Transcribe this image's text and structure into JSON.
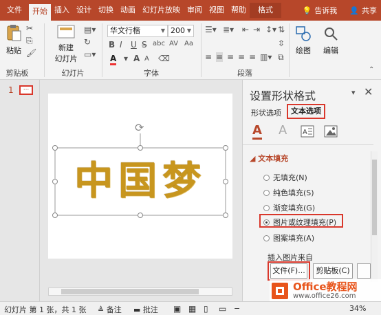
{
  "ribbon_tabs": [
    "文件",
    "开始",
    "插入",
    "设计",
    "切换",
    "动画",
    "幻灯片放映",
    "审阅",
    "视图",
    "帮助"
  ],
  "format_tab": "格式",
  "tell_me": "告诉我",
  "share": "共享",
  "clipboard": {
    "paste": "粘贴",
    "group_label": "剪贴板"
  },
  "slides": {
    "new_slide_line1": "新建",
    "new_slide_line2": "幻灯片",
    "group_label": "幻灯片"
  },
  "font": {
    "family": "华文行楷",
    "size": "200",
    "group_label": "字体",
    "bold": "B",
    "italic": "I",
    "underline": "U",
    "strike": "S",
    "shadow": "abc",
    "spacing": "AV",
    "case": "Aa",
    "color_a": "A",
    "grow": "A",
    "shrink": "A"
  },
  "paragraph": {
    "group_label": "段落"
  },
  "drawing": {
    "label": "绘图"
  },
  "editing": {
    "label": "编辑"
  },
  "thumbnail": {
    "number": "1",
    "placeholder": "···"
  },
  "slide_text": "中国梦",
  "pane": {
    "title": "设置形状格式",
    "tab_shape": "形状选项",
    "tab_text": "文本选项",
    "section": "文本填充",
    "options": [
      "无填充(N)",
      "纯色填充(S)",
      "渐变填充(G)",
      "图片或纹理填充(P)",
      "图案填充(A)"
    ],
    "selected_index": 3,
    "insert_from": "插入图片来自",
    "btn_file": "文件(F)...",
    "btn_clipboard": "剪贴板(C)"
  },
  "status": {
    "slide_info": "幻灯片 第 1 张，共 1 张",
    "notes": "备注",
    "comments": "批注",
    "zoom": "34%"
  },
  "watermark": {
    "brand": "Office教程网",
    "url": "www.office26.com"
  },
  "colors": {
    "accent": "#b7472a",
    "highlight": "#d9372b",
    "gold": "#c8961e"
  }
}
